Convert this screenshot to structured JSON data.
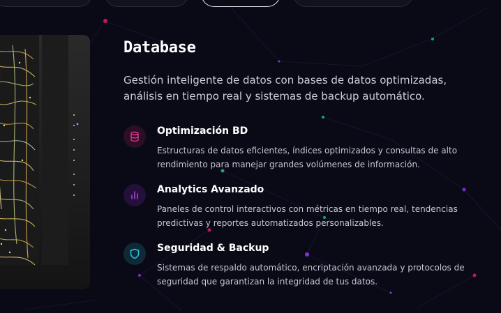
{
  "tabs": [
    {
      "label": ""
    },
    {
      "label": ""
    },
    {
      "label": ""
    },
    {
      "label": ""
    }
  ],
  "section": {
    "title": "Database",
    "description": "Gestión inteligente de datos con bases de datos optimizadas, análisis en tiempo real y sistemas de backup automático."
  },
  "features": [
    {
      "icon": "database-icon",
      "color": "#d63384",
      "title": "Optimización BD",
      "text": "Estructuras de datos eficientes, índices optimizados y consultas de alto rendimiento para manejar grandes volúmenes de información."
    },
    {
      "icon": "bar-chart-icon",
      "color": "#a03ad6",
      "title": "Analytics Avanzado",
      "text": "Paneles de control interactivos con métricas en tiempo real, tendencias predictivas y reportes automatizados personalizables."
    },
    {
      "icon": "shield-icon",
      "color": "#22b8d6",
      "title": "Seguridad & Backup",
      "text": "Sistemas de respaldo automático, encriptación avanzada y protocolos de seguridad que garantizan la integridad de tus datos."
    }
  ],
  "theme": {
    "background": "#0a0a17",
    "accent_pink": "#d63384",
    "accent_purple": "#a03ad6",
    "accent_cyan": "#22b8d6"
  }
}
